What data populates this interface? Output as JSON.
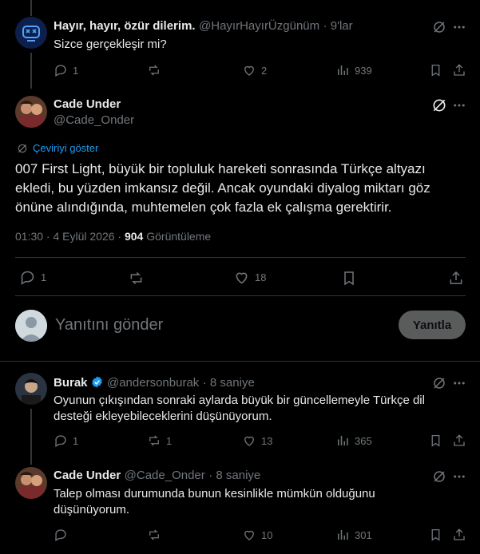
{
  "tweet1": {
    "name": "Hayır, hayır, özür dilerim.",
    "handle": "@HayırHayırÜzgünüm",
    "time": "· 9'lar",
    "text": "Sizce gerçekleşir mi?",
    "replies": "1",
    "retweets": "",
    "likes": "2",
    "views": "939"
  },
  "main": {
    "name": "Cade Under",
    "handle": "@Cade_Onder",
    "translate": "Çeviriyi göster",
    "text_line1": "007 First Light, büyük bir topluluk hareketi sonrasında Türkçe altyazı",
    "text_line2": "ekledi, bu yüzden imkansız değil. Ancak oyundaki diyalog miktarı göz",
    "text_line3": "önüne alındığında, muhtemelen çok fazla ek çalışma gerektirir.",
    "timestamp": "01:30 · 4 Eylül 2026 ·",
    "views_count": "904",
    "views_label": "Görüntüleme",
    "replies": "1",
    "likes": "18"
  },
  "composer": {
    "placeholder": "Yanıtını gönder",
    "button": "Yanıtla"
  },
  "reply1": {
    "name": "Burak",
    "handle": "@andersonburak",
    "time": "· 8 saniye",
    "text_line1": "Oyunun çıkışından sonraki aylarda büyük bir güncellemeyle Türkçe dil",
    "text_line2": "desteği ekleyebileceklerini düşünüyorum.",
    "replies": "1",
    "retweets": "1",
    "likes": "13",
    "views": "365"
  },
  "reply2": {
    "name": "Cade Under",
    "handle": "@Cade_Onder",
    "time": "· 8 saniye",
    "text_line1": "Talep olması durumunda bunun kesinlikle mümkün olduğunu",
    "text_line2": "düşünüyorum.",
    "replies": "",
    "retweets": "",
    "likes": "10",
    "views": "301"
  },
  "colors": {
    "background": "#000000",
    "text": "#e7e9ea",
    "muted": "#71767b",
    "divider": "#2f3336",
    "verified": "#1d9bf0"
  }
}
